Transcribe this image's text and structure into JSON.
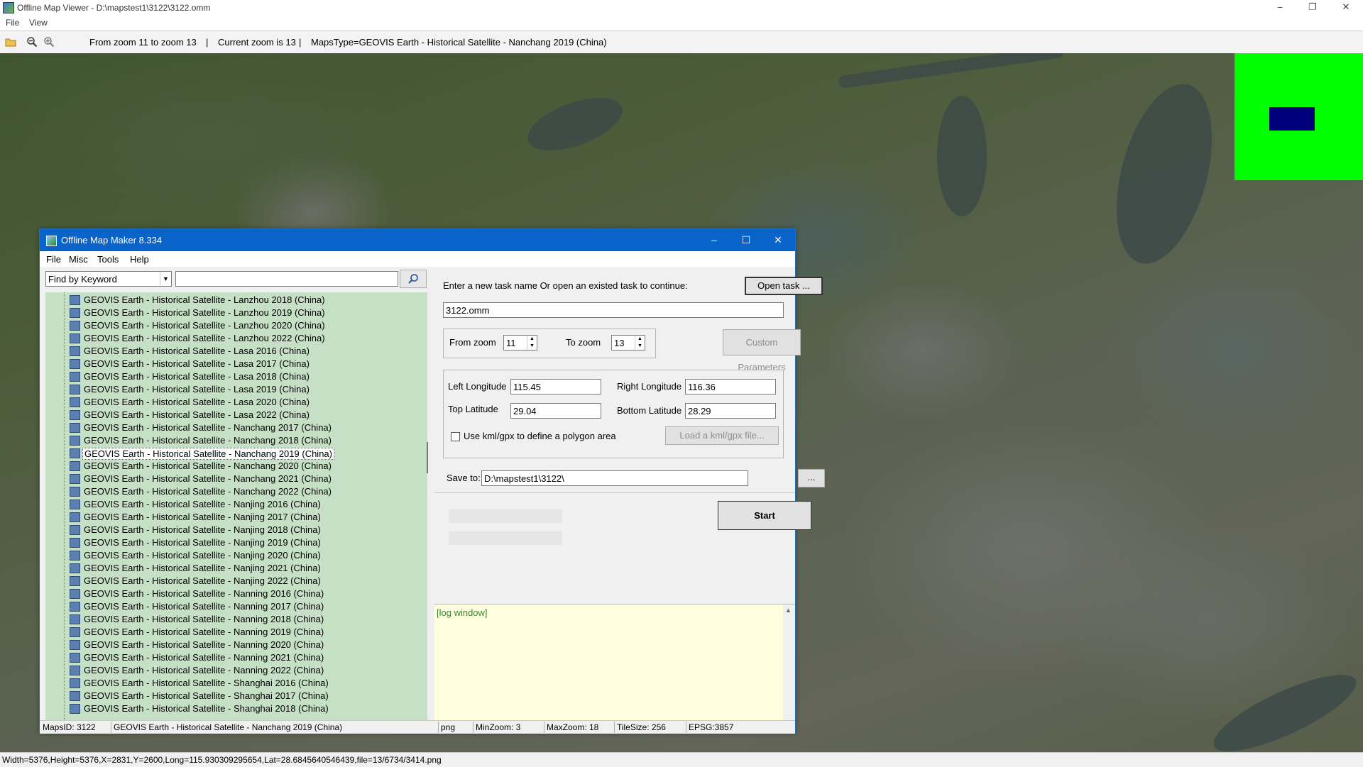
{
  "window": {
    "title": "Offline Map Viewer - D:\\mapstest1\\3122\\3122.omm",
    "minimize": "–",
    "maximize": "❐",
    "close": "✕"
  },
  "menu": {
    "file": "File",
    "view": "View"
  },
  "toolbar": {
    "zoom_range": "From zoom 11 to zoom 13",
    "sep1": "|",
    "current_zoom": "Current zoom is 13",
    "sep2": "|",
    "maps_type": "MapsType=GEOVIS Earth - Historical Satellite - Nanchang 2019 (China)"
  },
  "status_bar": {
    "text": "Width=5376,Height=5376,X=2831,Y=2600,Long=115.930309295654,Lat=28.6845640546439,file=13/6734/3414.png"
  },
  "colors": {
    "minimap_bg": "#00ff00",
    "minimap_view": "#00007a",
    "dialog_title_bg": "#0a63c9",
    "tree_bg": "#c6e0c6",
    "log_bg": "#ffffe0"
  },
  "dialog": {
    "title": "Offline Map Maker 8.334",
    "minimize": "–",
    "maximize": "☐",
    "close": "✕",
    "menu": {
      "file": "File",
      "misc": "Misc",
      "tools": "Tools",
      "help": "Help"
    },
    "find_mode": "Find by Keyword",
    "search_value": "",
    "tree_items": [
      "GEOVIS Earth - Historical Satellite - Lanzhou 2018 (China)",
      "GEOVIS Earth - Historical Satellite - Lanzhou 2019 (China)",
      "GEOVIS Earth - Historical Satellite - Lanzhou 2020 (China)",
      "GEOVIS Earth - Historical Satellite - Lanzhou 2022 (China)",
      "GEOVIS Earth - Historical Satellite - Lasa 2016 (China)",
      "GEOVIS Earth - Historical Satellite - Lasa 2017 (China)",
      "GEOVIS Earth - Historical Satellite - Lasa 2018 (China)",
      "GEOVIS Earth - Historical Satellite - Lasa 2019 (China)",
      "GEOVIS Earth - Historical Satellite - Lasa 2020 (China)",
      "GEOVIS Earth - Historical Satellite - Lasa 2022 (China)",
      "GEOVIS Earth - Historical Satellite - Nanchang 2017 (China)",
      "GEOVIS Earth - Historical Satellite - Nanchang 2018 (China)",
      "GEOVIS Earth - Historical Satellite - Nanchang 2019 (China)",
      "GEOVIS Earth - Historical Satellite - Nanchang 2020 (China)",
      "GEOVIS Earth - Historical Satellite - Nanchang 2021 (China)",
      "GEOVIS Earth - Historical Satellite - Nanchang 2022 (China)",
      "GEOVIS Earth - Historical Satellite - Nanjing 2016 (China)",
      "GEOVIS Earth - Historical Satellite - Nanjing 2017 (China)",
      "GEOVIS Earth - Historical Satellite - Nanjing 2018 (China)",
      "GEOVIS Earth - Historical Satellite - Nanjing 2019 (China)",
      "GEOVIS Earth - Historical Satellite - Nanjing 2020 (China)",
      "GEOVIS Earth - Historical Satellite - Nanjing 2021 (China)",
      "GEOVIS Earth - Historical Satellite - Nanjing 2022 (China)",
      "GEOVIS Earth - Historical Satellite - Nanning 2016 (China)",
      "GEOVIS Earth - Historical Satellite - Nanning 2017 (China)",
      "GEOVIS Earth - Historical Satellite - Nanning 2018 (China)",
      "GEOVIS Earth - Historical Satellite - Nanning 2019 (China)",
      "GEOVIS Earth - Historical Satellite - Nanning 2020 (China)",
      "GEOVIS Earth - Historical Satellite - Nanning 2021 (China)",
      "GEOVIS Earth - Historical Satellite - Nanning 2022 (China)",
      "GEOVIS Earth - Historical Satellite - Shanghai 2016 (China)",
      "GEOVIS Earth - Historical Satellite - Shanghai 2017 (China)",
      "GEOVIS Earth - Historical Satellite - Shanghai 2018 (China)"
    ],
    "selected_index": 12,
    "task_prompt": "Enter a new task name Or open an existed task to continue:",
    "open_task_label": "Open task ...",
    "task_name": "3122.omm",
    "from_zoom_label": "From zoom",
    "from_zoom": "11",
    "to_zoom_label": "To zoom",
    "to_zoom": "13",
    "custom_params_label": "Custom Parameters",
    "left_lon_label": "Left Longitude",
    "left_lon": "115.45",
    "right_lon_label": "Right Longitude",
    "right_lon": "116.36",
    "top_lat_label": "Top Latitude",
    "top_lat": "29.04",
    "bottom_lat_label": "Bottom Latitude",
    "bottom_lat": "28.29",
    "kml_label": "Use kml/gpx to define a polygon area",
    "load_kml_label": "Load a kml/gpx file...",
    "save_to_label": "Save to:",
    "save_to": "D:\\mapstest1\\3122\\",
    "browse_label": "...",
    "start_label": "Start",
    "log_label": "[log window]",
    "status": {
      "maps_id": "MapsID: 3122",
      "maps_name": "GEOVIS Earth - Historical Satellite - Nanchang 2019 (China)",
      "format": "png",
      "min_zoom": "MinZoom: 3",
      "max_zoom": "MaxZoom: 18",
      "tile_size": "TileSize: 256",
      "epsg": "EPSG:3857"
    }
  }
}
